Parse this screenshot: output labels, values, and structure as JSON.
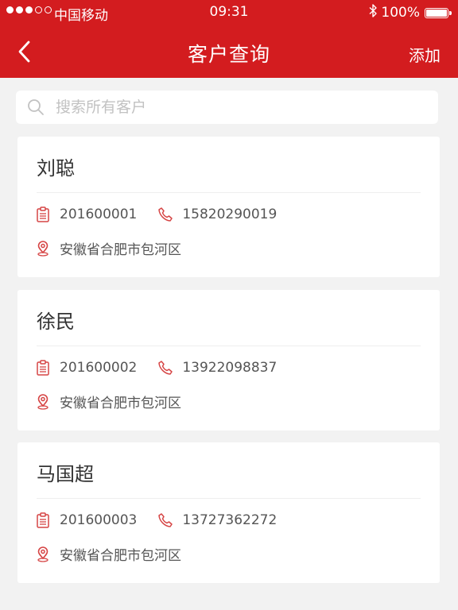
{
  "status_bar": {
    "carrier": "中国移动",
    "time": "09:31",
    "battery": "100%"
  },
  "nav": {
    "title": "客户查询",
    "add_label": "添加"
  },
  "search": {
    "placeholder": "搜索所有客户"
  },
  "customers": [
    {
      "name": "刘聪",
      "id": "201600001",
      "phone": "15820290019",
      "address": "安徽省合肥市包河区"
    },
    {
      "name": "徐民",
      "id": "201600002",
      "phone": "13922098837",
      "address": "安徽省合肥市包河区"
    },
    {
      "name": "马国超",
      "id": "201600003",
      "phone": "13727362272",
      "address": "安徽省合肥市包河区"
    }
  ],
  "colors": {
    "brand": "#d31c1f",
    "background": "#f2f2f2",
    "icon": "#d64545"
  }
}
